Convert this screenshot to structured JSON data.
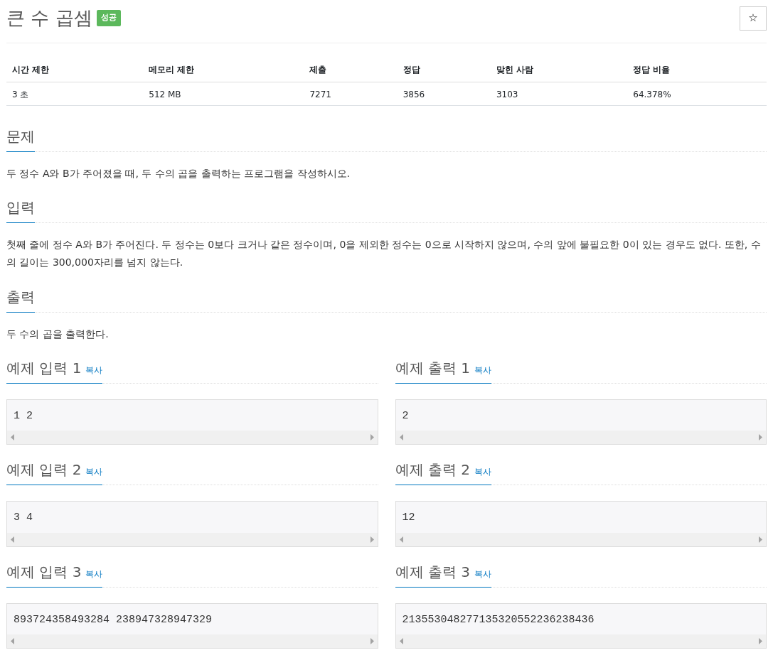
{
  "title": "큰 수 곱셈",
  "status_badge": "성공",
  "star_button": "☆",
  "info_table": {
    "columns": [
      "시간 제한",
      "메모리 제한",
      "제출",
      "정답",
      "맞힌 사람",
      "정답 비율"
    ],
    "rows": [
      [
        "3 초",
        "512 MB",
        "7271",
        "3856",
        "3103",
        "64.378%"
      ]
    ]
  },
  "sections": [
    {
      "heading": "문제",
      "body": "두 정수 A와 B가 주어졌을 때, 두 수의 곱을 출력하는 프로그램을 작성하시오."
    },
    {
      "heading": "입력",
      "body": "첫째 줄에 정수 A와 B가 주어진다. 두 정수는 0보다 크거나 같은 정수이며, 0을 제외한 정수는 0으로 시작하지 않으며, 수의 앞에 불필요한 0이 있는 경우도 없다. 또한, 수의 길이는 300,000자리를 넘지 않는다."
    },
    {
      "heading": "출력",
      "body": "두 수의 곱을 출력한다."
    }
  ],
  "examples": [
    {
      "input_heading": "예제 입력 1",
      "input_copy": "복사",
      "input": "1 2",
      "output_heading": "예제 출력 1",
      "output_copy": "복사",
      "output": "2"
    },
    {
      "input_heading": "예제 입력 2",
      "input_copy": "복사",
      "input": "3 4",
      "output_heading": "예제 출력 2",
      "output_copy": "복사",
      "output": "12"
    },
    {
      "input_heading": "예제 입력 3",
      "input_copy": "복사",
      "input": "893724358493284 238947328947329",
      "output_heading": "예제 출력 3",
      "output_copy": "복사",
      "output": "213553048277135320552236238436"
    }
  ]
}
